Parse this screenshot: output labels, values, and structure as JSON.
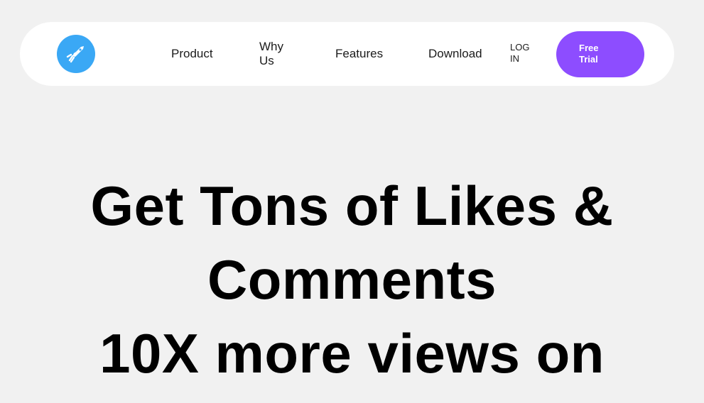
{
  "nav": {
    "logo_icon": "rocket-figure-icon",
    "links": {
      "product": "Product",
      "why_us": "Why Us",
      "features": "Features",
      "download": "Download",
      "login": "LOG IN"
    },
    "cta": "Free Trial"
  },
  "hero": {
    "line1": "Get Tons of Likes &",
    "line2": "Comments",
    "line3": "10X more views on"
  },
  "colors": {
    "background": "#f1f1f1",
    "logo": "#3aa8f5",
    "cta": "#8d4dff"
  }
}
